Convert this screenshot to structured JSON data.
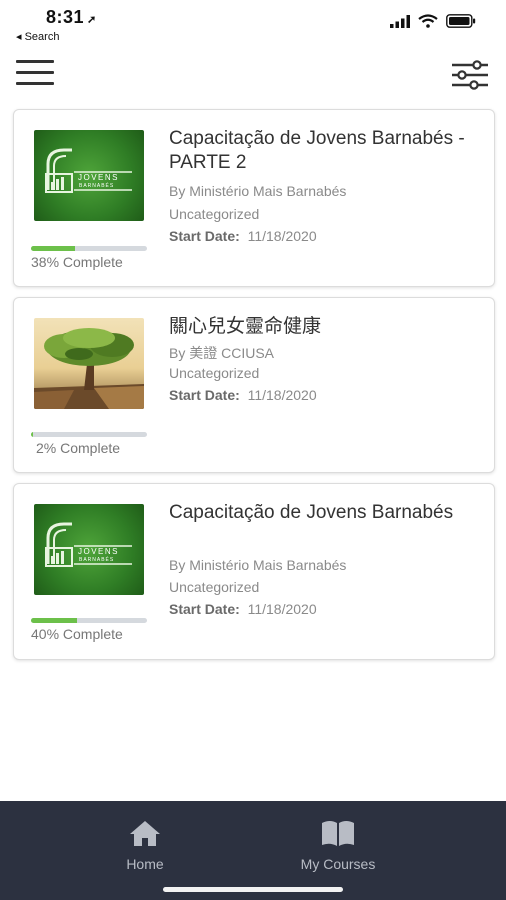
{
  "status_bar": {
    "time": "8:31",
    "back_label": "◂ Search"
  },
  "courses": [
    {
      "title": "Capacitação de Jovens Barnabés - PARTE 2",
      "author": "By Ministério Mais Barnabés",
      "category": "Uncategorized",
      "start_label": "Start Date:",
      "start_date": "11/18/2020",
      "progress": 38,
      "progress_label": "38% Complete",
      "thumb_text_1": "JOVENS",
      "thumb_text_2": "BARNABÉS"
    },
    {
      "title": "關心兒女靈命健康",
      "author": "By 美證 CCIUSA",
      "category": "Uncategorized",
      "start_label": "Start Date:",
      "start_date": "11/18/2020",
      "progress": 2,
      "progress_label": "2% Complete"
    },
    {
      "title": "Capacitação de Jovens Barnabés",
      "author": "By Ministério Mais Barnabés",
      "category": "Uncategorized",
      "start_label": "Start Date:",
      "start_date": "11/18/2020",
      "progress": 40,
      "progress_label": "40% Complete",
      "thumb_text_1": "JOVENS",
      "thumb_text_2": "BARNABÉS"
    }
  ],
  "tab_bar": {
    "home_label": "Home",
    "courses_label": "My Courses"
  },
  "colors": {
    "progress_fill": "#6cc04a",
    "progress_track": "#d5d9de",
    "tab_bar_bg": "#2c3140",
    "thumb_green": "#2f7d25"
  },
  "icons": {
    "menu": "hamburger-icon",
    "filter": "sliders-icon",
    "home": "home-icon",
    "courses": "open-book-icon"
  }
}
